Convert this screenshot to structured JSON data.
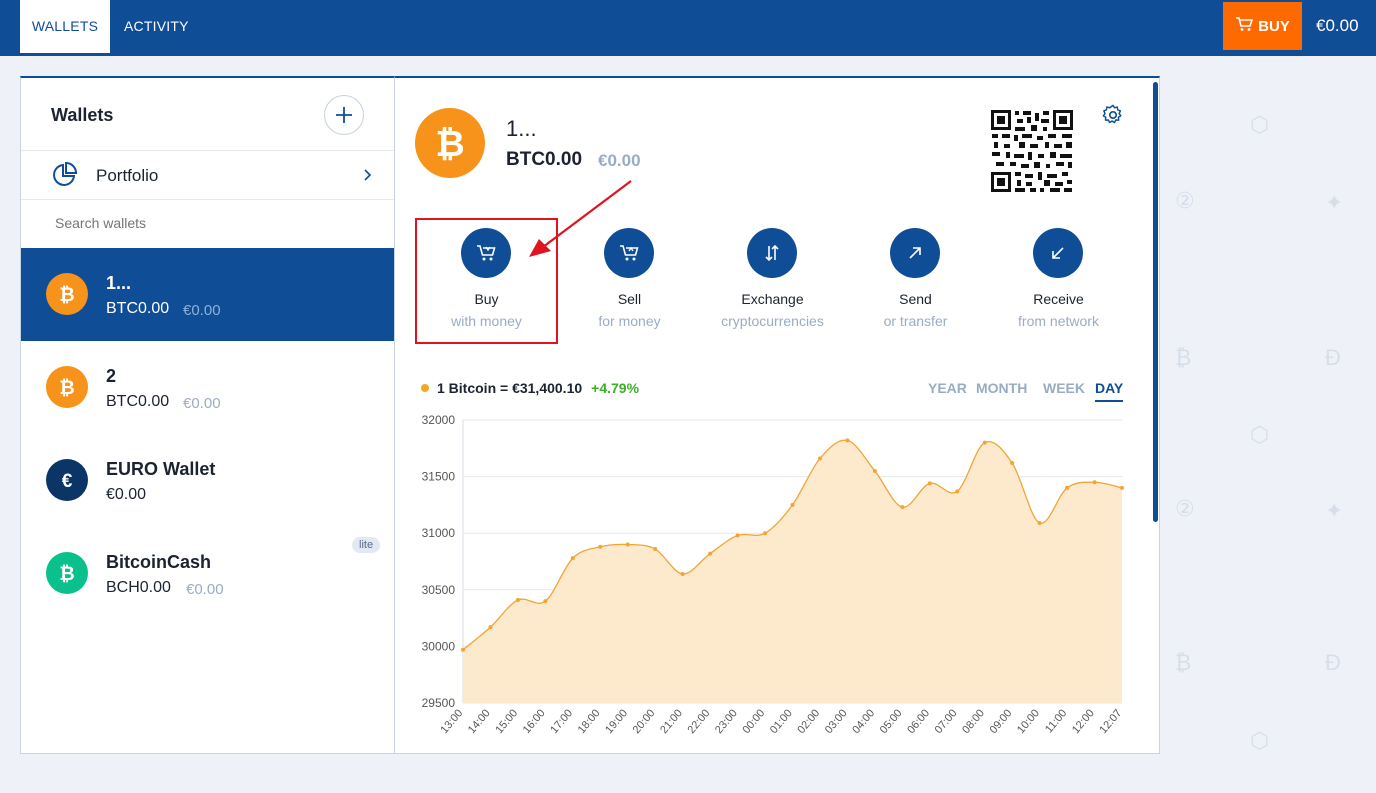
{
  "topbar": {
    "tabs": [
      {
        "label": "WALLETS",
        "active": true
      },
      {
        "label": "ACTIVITY",
        "active": false
      }
    ],
    "buy_label": "BUY",
    "balance": "€0.00"
  },
  "wallets_panel": {
    "title": "Wallets",
    "portfolio_label": "Portfolio",
    "search_placeholder": "Search wallets",
    "items": [
      {
        "name": "1...",
        "balance": "BTC0.00",
        "fiat": "€0.00",
        "icon": "bitcoin-icon",
        "color": "#f7931a",
        "active": true
      },
      {
        "name": "2",
        "balance": "BTC0.00",
        "fiat": "€0.00",
        "icon": "bitcoin-icon",
        "color": "#f7931a",
        "active": false
      },
      {
        "name": "EURO Wallet",
        "balance": "€0.00",
        "fiat": "",
        "icon": "euro-icon",
        "color": "#0b3566",
        "active": false
      },
      {
        "name": "BitcoinCash",
        "balance": "BCH0.00",
        "fiat": "€0.00",
        "icon": "bitcoin-cash-icon",
        "color": "#0ac18e",
        "badge": "lite",
        "active": false
      }
    ]
  },
  "wallet_detail": {
    "name": "1...",
    "balance": "BTC0.00",
    "fiat": "€0.00",
    "actions": [
      {
        "title": "Buy",
        "subtitle": "with money",
        "icon": "cart-buy-icon"
      },
      {
        "title": "Sell",
        "subtitle": "for money",
        "icon": "cart-sell-icon"
      },
      {
        "title": "Exchange",
        "subtitle": "cryptocurrencies",
        "icon": "exchange-arrows-icon"
      },
      {
        "title": "Send",
        "subtitle": "or transfer",
        "icon": "arrow-up-right-icon"
      },
      {
        "title": "Receive",
        "subtitle": "from network",
        "icon": "arrow-down-left-icon"
      }
    ],
    "price_label": "1 Bitcoin = €31,400.10",
    "price_change": "+4.79%",
    "periods": [
      "YEAR",
      "MONTH",
      "WEEK",
      "DAY"
    ],
    "active_period": "DAY"
  },
  "colors": {
    "brand": "#0f4d96",
    "buy_button": "#ff6a00",
    "bitcoin": "#f7931a",
    "positive": "#3fae29",
    "highlight": "#e0131f"
  },
  "chart_data": {
    "type": "area",
    "x": [
      "13:00",
      "14:00",
      "15:00",
      "16:00",
      "17:00",
      "18:00",
      "19:00",
      "20:00",
      "21:00",
      "22:00",
      "23:00",
      "00:00",
      "01:00",
      "02:00",
      "03:00",
      "04:00",
      "05:00",
      "06:00",
      "07:00",
      "08:00",
      "09:00",
      "10:00",
      "11:00",
      "12:00",
      "12:07"
    ],
    "series": [
      {
        "values": [
          29970,
          30170,
          30410,
          30400,
          30780,
          30880,
          30900,
          30860,
          30640,
          30820,
          30980,
          31000,
          31250,
          31660,
          31820,
          31550,
          31230,
          31440,
          31370,
          31800,
          31620,
          31090,
          31400,
          31450,
          31400
        ]
      }
    ],
    "ylim": [
      29500,
      32000
    ],
    "yticks": [
      29500,
      30000,
      30500,
      31000,
      31500,
      32000
    ],
    "grid": true
  }
}
